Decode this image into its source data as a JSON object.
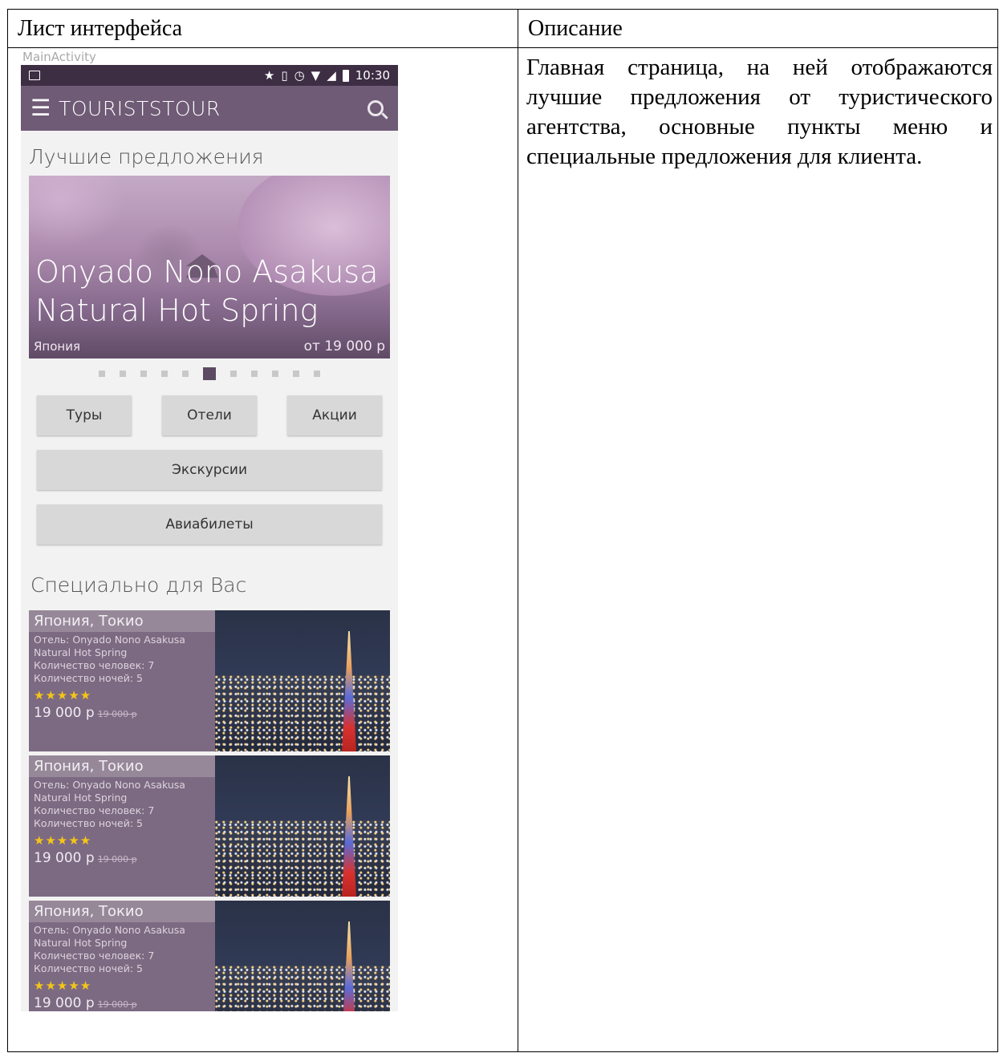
{
  "table": {
    "header_left": "Лист интерфейса",
    "header_right": "Описание",
    "description": "Главная страница, на ней отображаются лучшие предложения от туристического агентства, основные пункты меню и специальные предложения для клиента."
  },
  "phone": {
    "activity_label": "MainActivity",
    "status_time": "10:30",
    "app_title": "TOURISTSTOUR",
    "best_offers_title": "Лучшие предложения",
    "hero": {
      "title": "Onyado Nono Asakusa Natural Hot Spring",
      "country": "Япония",
      "price": "от 19 000 р"
    },
    "carousel": {
      "total": 11,
      "active_index": 5
    },
    "buttons": {
      "tours": "Туры",
      "hotels": "Отели",
      "promotions": "Акции",
      "excursions": "Экскурсии",
      "flights": "Авиабилеты"
    },
    "special_title": "Специально для Вас",
    "cards": [
      {
        "location": "Япония, Токио",
        "hotel_line1": "Отель: Onyado Nono Asakusa",
        "hotel_line2": "Natural Hot Spring",
        "people": "Количество человек: 7",
        "nights": "Количество ночей: 5",
        "rating": 5,
        "stars": "★★★★★",
        "price": "19 000 р",
        "old_price": "19 000 р"
      },
      {
        "location": "Япония, Токио",
        "hotel_line1": "Отель: Onyado Nono Asakusa",
        "hotel_line2": "Natural Hot Spring",
        "people": "Количество человек: 7",
        "nights": "Количество ночей: 5",
        "rating": 5,
        "stars": "★★★★★",
        "price": "19 000 р",
        "old_price": "19 000 р"
      },
      {
        "location": "Япония, Токио",
        "hotel_line1": "Отель: Onyado Nono Asakusa",
        "hotel_line2": "Natural Hot Spring",
        "people": "Количество человек: 7",
        "nights": "Количество ночей: 5",
        "rating": 5,
        "stars": "★★★★★",
        "price": "19 000 р",
        "old_price": "19 000 р"
      }
    ],
    "colors": {
      "status_bar": "#3d2e44",
      "app_bar": "#6f5b76",
      "accent": "#5c4a63",
      "star": "#f5c518"
    },
    "icons": [
      "menu-icon",
      "search-icon",
      "star-icon",
      "vibrate-icon",
      "alarm-icon",
      "wifi-icon",
      "signal-icon",
      "battery-icon",
      "image-icon"
    ]
  }
}
